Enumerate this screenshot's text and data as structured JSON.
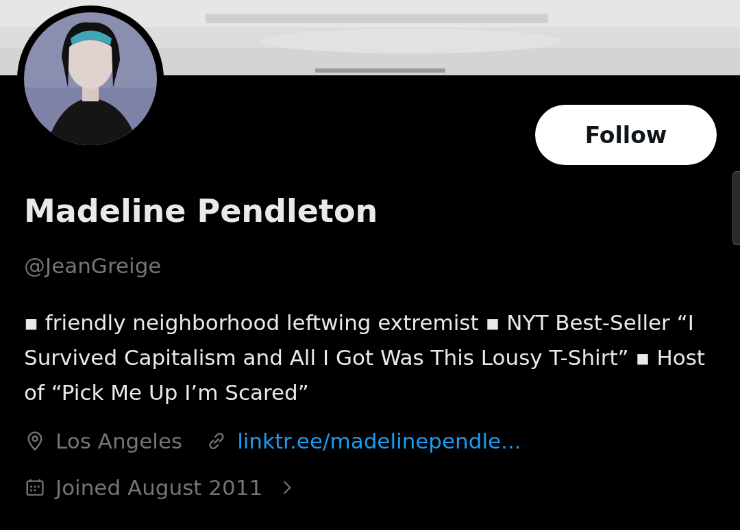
{
  "follow_button": {
    "label": "Follow"
  },
  "profile": {
    "name": "Madeline Pendleton",
    "handle": "@JeanGreige",
    "bio": "▪ friendly neighborhood leftwing extremist ▪ NYT Best-Seller “I Survived Capitalism and All I Got Was This Lousy T-Shirt” ▪ Host of “Pick Me Up I’m Scared”",
    "location": "Los Angeles",
    "link": "linktr.ee/madelinependle...",
    "joined": "Joined August 2011"
  }
}
